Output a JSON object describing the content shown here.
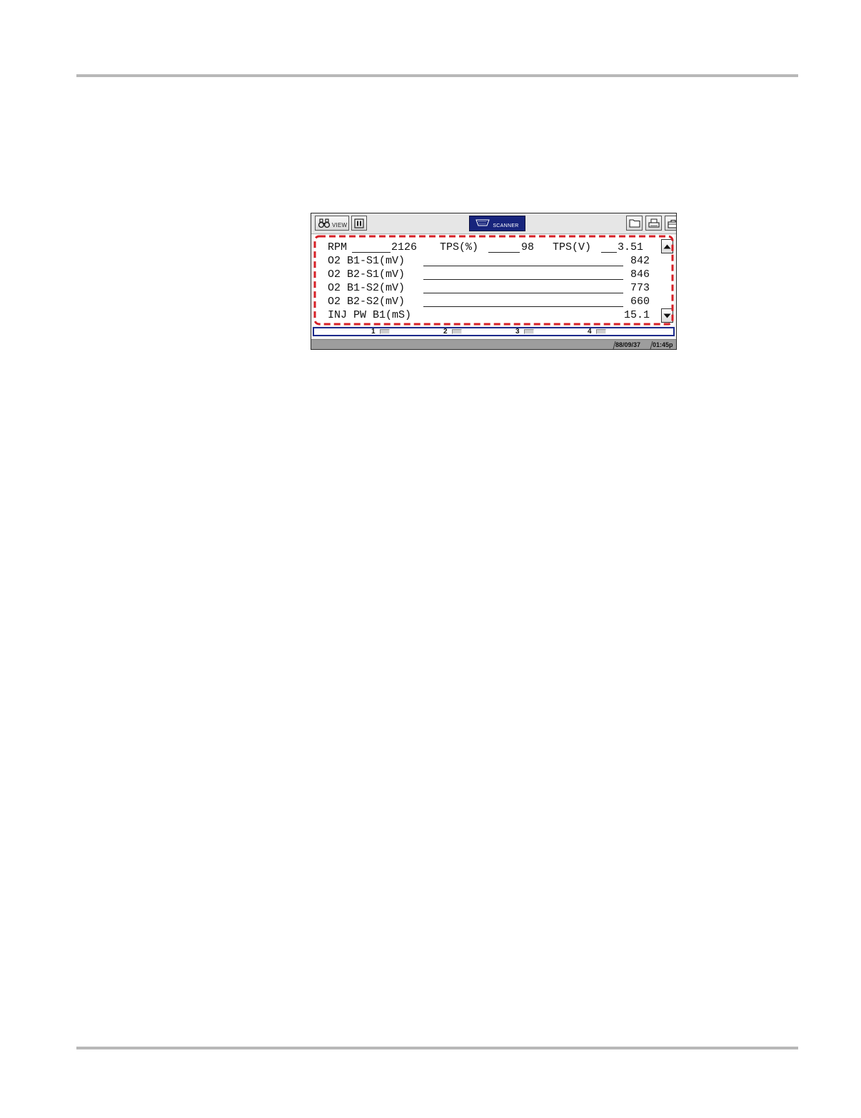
{
  "toolbar": {
    "view_label": "VIEW",
    "scanner_label": "SCANNER"
  },
  "pid_list": {
    "top_row": {
      "rpm_label": "RPM",
      "rpm_value": "2126",
      "tps_pct_label": "TPS(%)",
      "tps_pct_value": "98",
      "tps_v_label": "TPS(V)",
      "tps_v_value": "3.51"
    },
    "rows": [
      {
        "label": "O2 B1-S1(mV)",
        "value": "842"
      },
      {
        "label": "O2 B2-S1(mV)",
        "value": "846"
      },
      {
        "label": "O2 B1-S2(mV)",
        "value": "773"
      },
      {
        "label": "O2 B2-S2(mV)",
        "value": "660"
      },
      {
        "label": "INJ PW B1(mS)",
        "value": "15.1"
      }
    ]
  },
  "channels": [
    {
      "label": "1"
    },
    {
      "label": "2"
    },
    {
      "label": "3"
    },
    {
      "label": "4"
    }
  ],
  "status": {
    "date": "88/09/37",
    "time": "01:45p"
  },
  "colors": {
    "highlight_dash": "#d61f26",
    "scanner_tab": "#17247c",
    "channel_strip_border": "#1c2a8c"
  },
  "icons": {
    "view": "binoculars-icon",
    "pause": "pause-icon",
    "scanner": "obd-connector-icon",
    "folder": "folder-icon",
    "print": "printer-icon",
    "tools": "toolbox-icon",
    "scroll_up": "arrow-up-icon",
    "scroll_down": "arrow-down-icon"
  }
}
